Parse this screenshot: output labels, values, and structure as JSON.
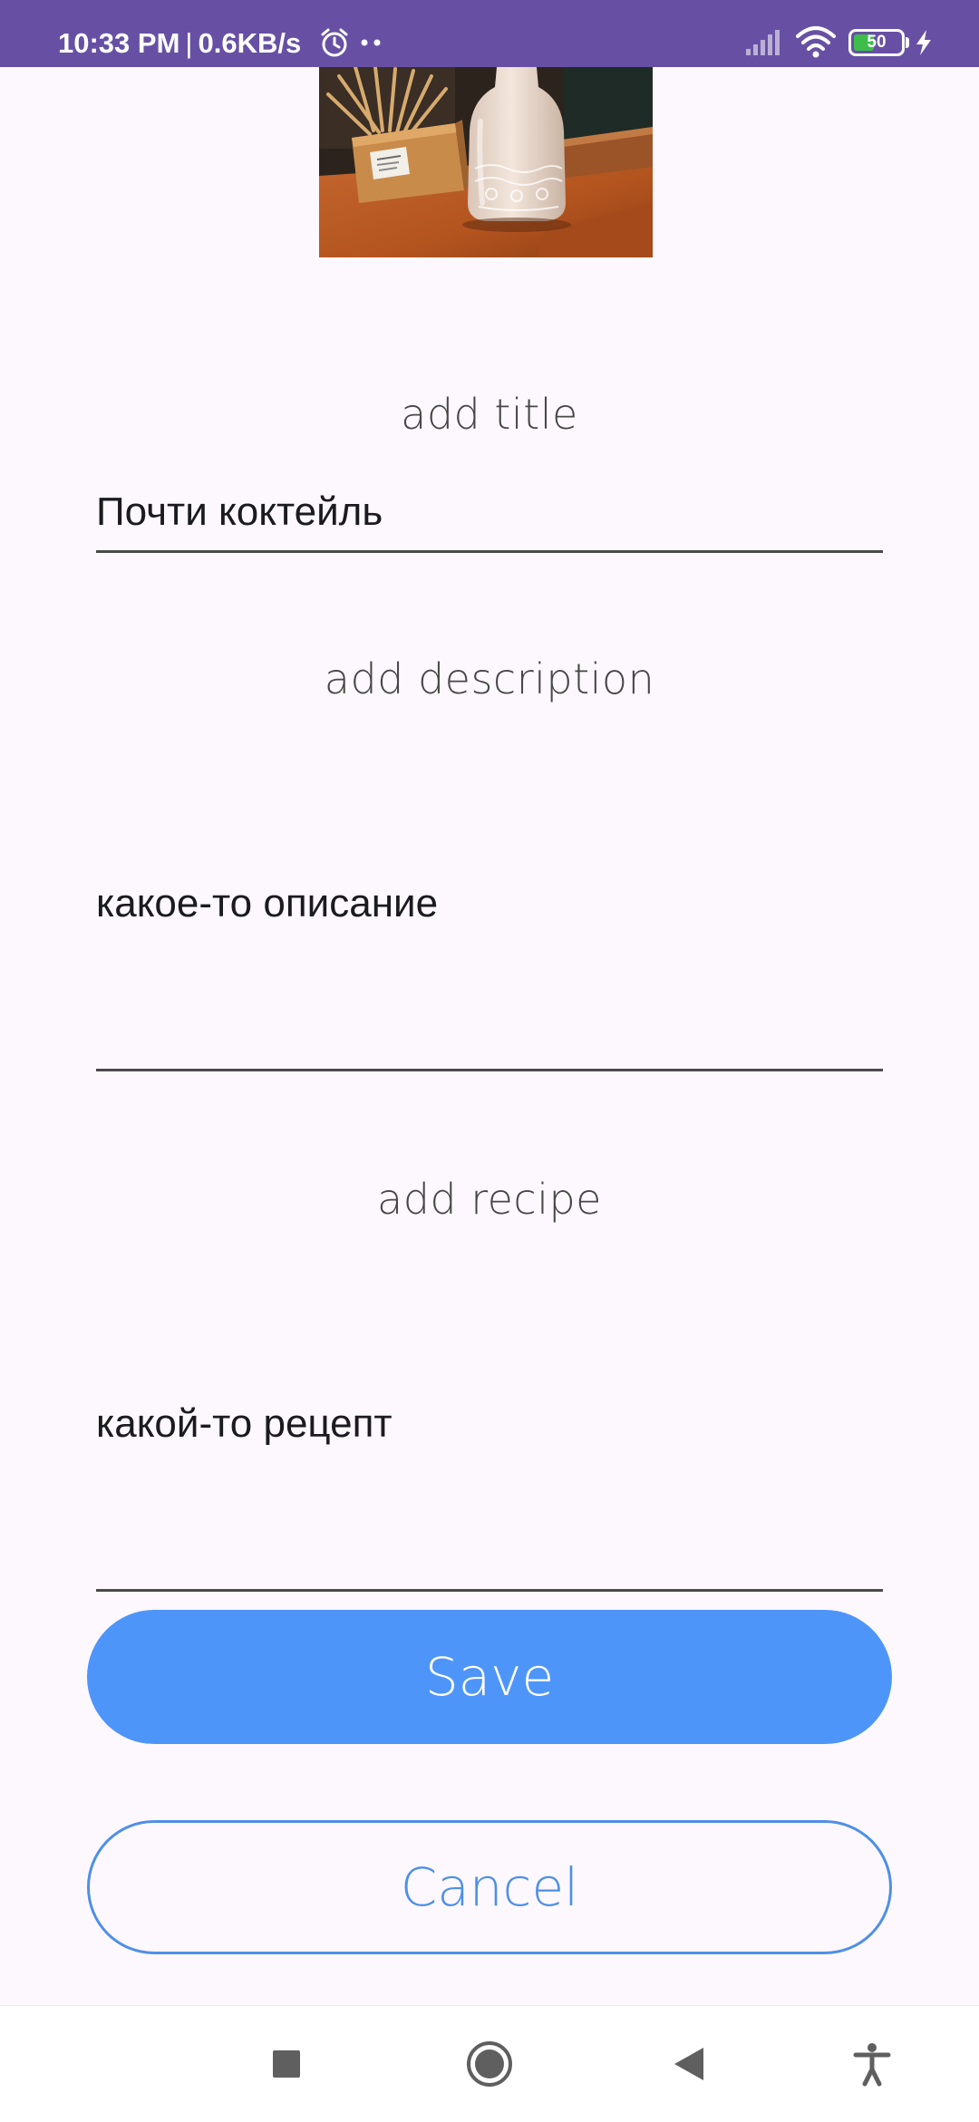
{
  "status_bar": {
    "time": "10:33 PM",
    "separator": "|",
    "net_speed": "0.6KB/s",
    "battery_level": "50",
    "battery_fraction": 0.5,
    "icons": [
      "alarm-icon",
      "signal-icon",
      "wifi-icon",
      "battery-icon",
      "charging-bolt-icon"
    ]
  },
  "form": {
    "title_label": "add title",
    "title_value": "Почти коктейль",
    "description_label": "add description",
    "description_value": "какое-то описание",
    "recipe_label": "add recipe",
    "recipe_value": "какой-то рецепт"
  },
  "actions": {
    "save_label": "Save",
    "cancel_label": "Cancel"
  },
  "nav_bar": {
    "icons": [
      "recents-square-icon",
      "home-circle-icon",
      "back-triangle-icon",
      "accessibility-icon"
    ]
  },
  "colors": {
    "status_bar": "#6750A4",
    "background": "#FDF8FD",
    "save_button": "#4E95FA",
    "cancel_outline": "#4E8FE8",
    "battery_fill": "#3DBE4B"
  }
}
